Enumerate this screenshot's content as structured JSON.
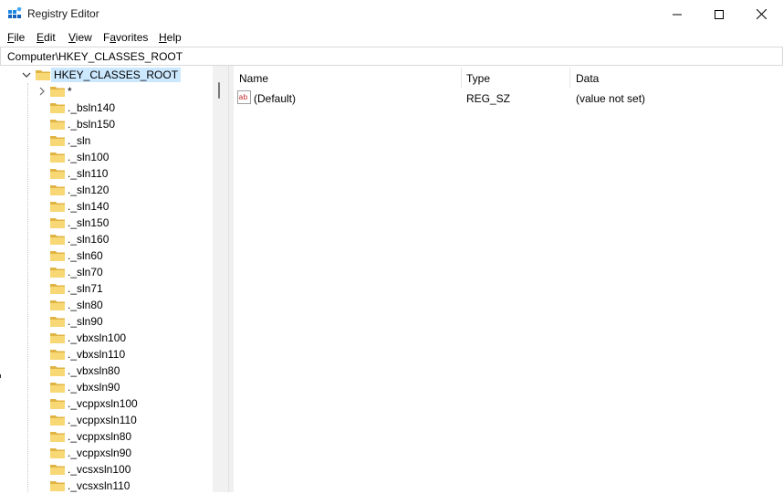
{
  "window": {
    "title": "Registry Editor",
    "controls": [
      "minimize",
      "maximize",
      "close"
    ]
  },
  "menu": [
    {
      "label": "File",
      "accel": "F",
      "rest": "ile"
    },
    {
      "label": "Edit",
      "accel": "E",
      "rest": "dit"
    },
    {
      "label": "View",
      "accel": "V",
      "rest": "iew"
    },
    {
      "label": "Favorites",
      "accel": "a",
      "pre": "F",
      "rest": "vorites"
    },
    {
      "label": "Help",
      "accel": "H",
      "rest": "elp"
    }
  ],
  "address": "Computer\\HKEY_CLASSES_ROOT",
  "tree": {
    "root": "HKEY_CLASSES_ROOT",
    "items": [
      "*",
      "._bsln140",
      "._bsln150",
      "._sln",
      "._sln100",
      "._sln110",
      "._sln120",
      "._sln140",
      "._sln150",
      "._sln160",
      "._sln60",
      "._sln70",
      "._sln71",
      "._sln80",
      "._sln90",
      "._vbxsln100",
      "._vbxsln110",
      "._vbxsln80",
      "._vbxsln90",
      "._vcppxsln100",
      "._vcppxsln110",
      "._vcppxsln80",
      "._vcppxsln90",
      "._vcsxsln100",
      "._vcsxsln110"
    ]
  },
  "list": {
    "columns": [
      "Name",
      "Type",
      "Data"
    ],
    "rows": [
      {
        "name": "(Default)",
        "type": "REG_SZ",
        "data": "(value not set)",
        "icon": "string-value-icon"
      }
    ]
  },
  "colors": {
    "selection": "#cce8ff",
    "folder": "#f8d775",
    "folder_dark": "#e0b443"
  }
}
